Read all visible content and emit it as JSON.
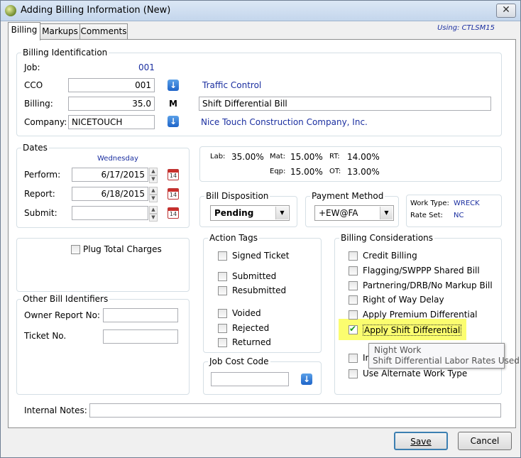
{
  "window": {
    "title": "Adding Billing Information  (New)",
    "close_glyph": "✕"
  },
  "tabs": [
    "Billing",
    "Markups",
    "Comments"
  ],
  "using": "Using: CTLSM15",
  "billing_identification": {
    "title": "Billing Identification",
    "job_label": "Job:",
    "job_value": "001",
    "cco_label": "CCO",
    "cco_value": "001",
    "cco_desc": "Traffic Control",
    "billing_label": "Billing:",
    "billing_value": "35.0",
    "billing_flag": "M",
    "billing_desc": "Shift Differential Bill",
    "company_label": "Company:",
    "company_value": "NICETOUCH",
    "company_desc": "Nice Touch Construction Company, Inc."
  },
  "dates": {
    "title": "Dates",
    "weekday": "Wednesday",
    "perform_label": "Perform:",
    "perform_value": "6/17/2015",
    "report_label": "Report:",
    "report_value": "6/18/2015",
    "submit_label": "Submit:",
    "submit_value": "",
    "calendar_day": "14"
  },
  "rates": {
    "lab_label": "Lab:",
    "lab_value": "35.00%",
    "mat_label": "Mat:",
    "mat_value": "15.00%",
    "rt_label": "RT:",
    "rt_value": "14.00%",
    "eqp_label": "Eqp:",
    "eqp_value": "15.00%",
    "ot_label": "OT:",
    "ot_value": "13.00%"
  },
  "bill_disposition": {
    "title": "Bill Disposition",
    "value": "Pending"
  },
  "payment_method": {
    "title": "Payment Method",
    "value": "+EW@FA"
  },
  "work_info": {
    "work_type_label": "Work Type:",
    "work_type_value": "WRECK",
    "rate_set_label": "Rate Set:",
    "rate_set_value": "NC"
  },
  "plug_total": {
    "label": "Plug Total Charges",
    "checked": false
  },
  "other_identifiers": {
    "title": "Other Bill Identifiers",
    "owner_label": "Owner Report No:",
    "ticket_label": "Ticket No."
  },
  "action_tags": {
    "title": "Action Tags",
    "items": [
      "Signed Ticket",
      "Submitted",
      "Resubmitted",
      "Voided",
      "Rejected",
      "Returned"
    ]
  },
  "job_cost_code": {
    "title": "Job Cost Code",
    "value": ""
  },
  "billing_considerations": {
    "title": "Billing Considerations",
    "items": [
      "Credit Billing",
      "Flagging/SWPPP Shared Bill",
      "Partnering/DRB/No Markup Bill",
      "Right of Way Delay",
      "Apply Premium Differential",
      "Apply Shift Differential",
      "In",
      "Use Alternate Work Type"
    ],
    "checked": [
      false,
      false,
      false,
      false,
      false,
      true,
      false,
      false
    ]
  },
  "tooltip": {
    "line1": "Night Work",
    "line2": "Shift Differential Labor Rates Used"
  },
  "internal_notes": {
    "label": "Internal Notes:",
    "value": ""
  },
  "buttons": {
    "save": "Save",
    "cancel": "Cancel"
  },
  "colors": {
    "link_blue": "#1b2fa0",
    "highlight": "#fbfd6f",
    "check_green": "#1a9b1a"
  },
  "icons": [
    "app-icon",
    "close-icon",
    "lookup-arrow-icon",
    "calendar-icon",
    "checkbox-icon",
    "dropdown-arrow-icon"
  ]
}
